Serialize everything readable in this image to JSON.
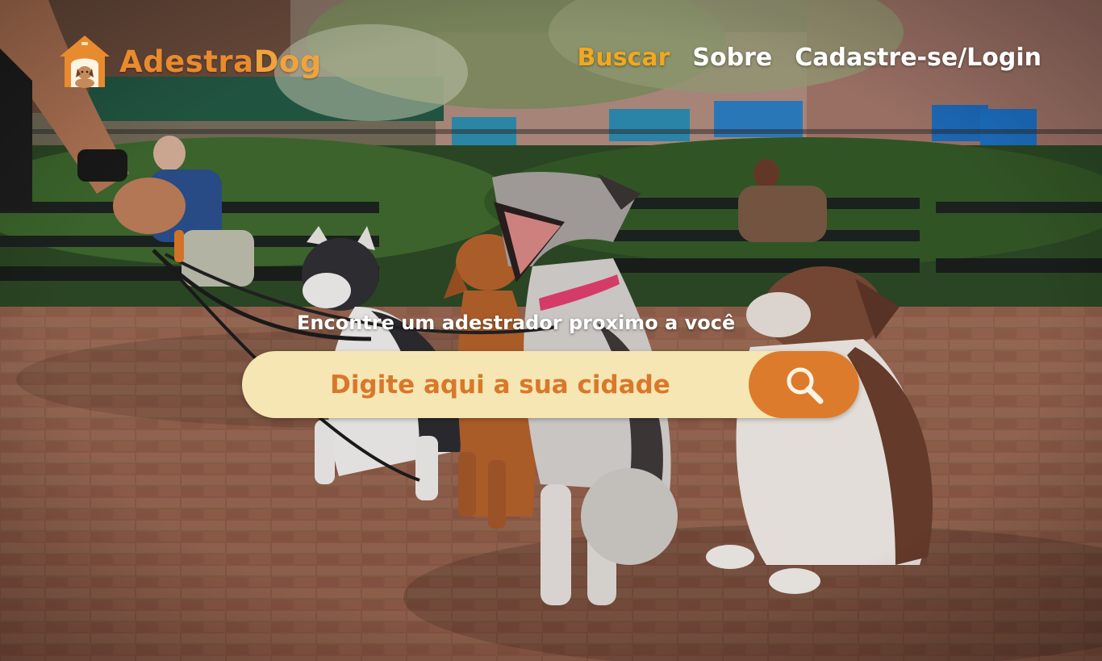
{
  "brand": {
    "name_part1": "Adestra",
    "name_part2": "Dog"
  },
  "nav": {
    "items": [
      {
        "label": "Buscar",
        "active": true
      },
      {
        "label": "Sobre",
        "active": false
      },
      {
        "label": "Cadastre-se/Login",
        "active": false
      }
    ]
  },
  "hero": {
    "tagline": "Encontre um adestrador proximo a você",
    "search": {
      "placeholder": "Digite aqui a sua cidade",
      "value": "",
      "button_icon": "search-icon"
    }
  },
  "colors": {
    "brand_orange": "#e88a2e",
    "nav_active": "#f2a81f",
    "search_bar": "#f5e6b3",
    "search_button": "#dd7b2c"
  }
}
